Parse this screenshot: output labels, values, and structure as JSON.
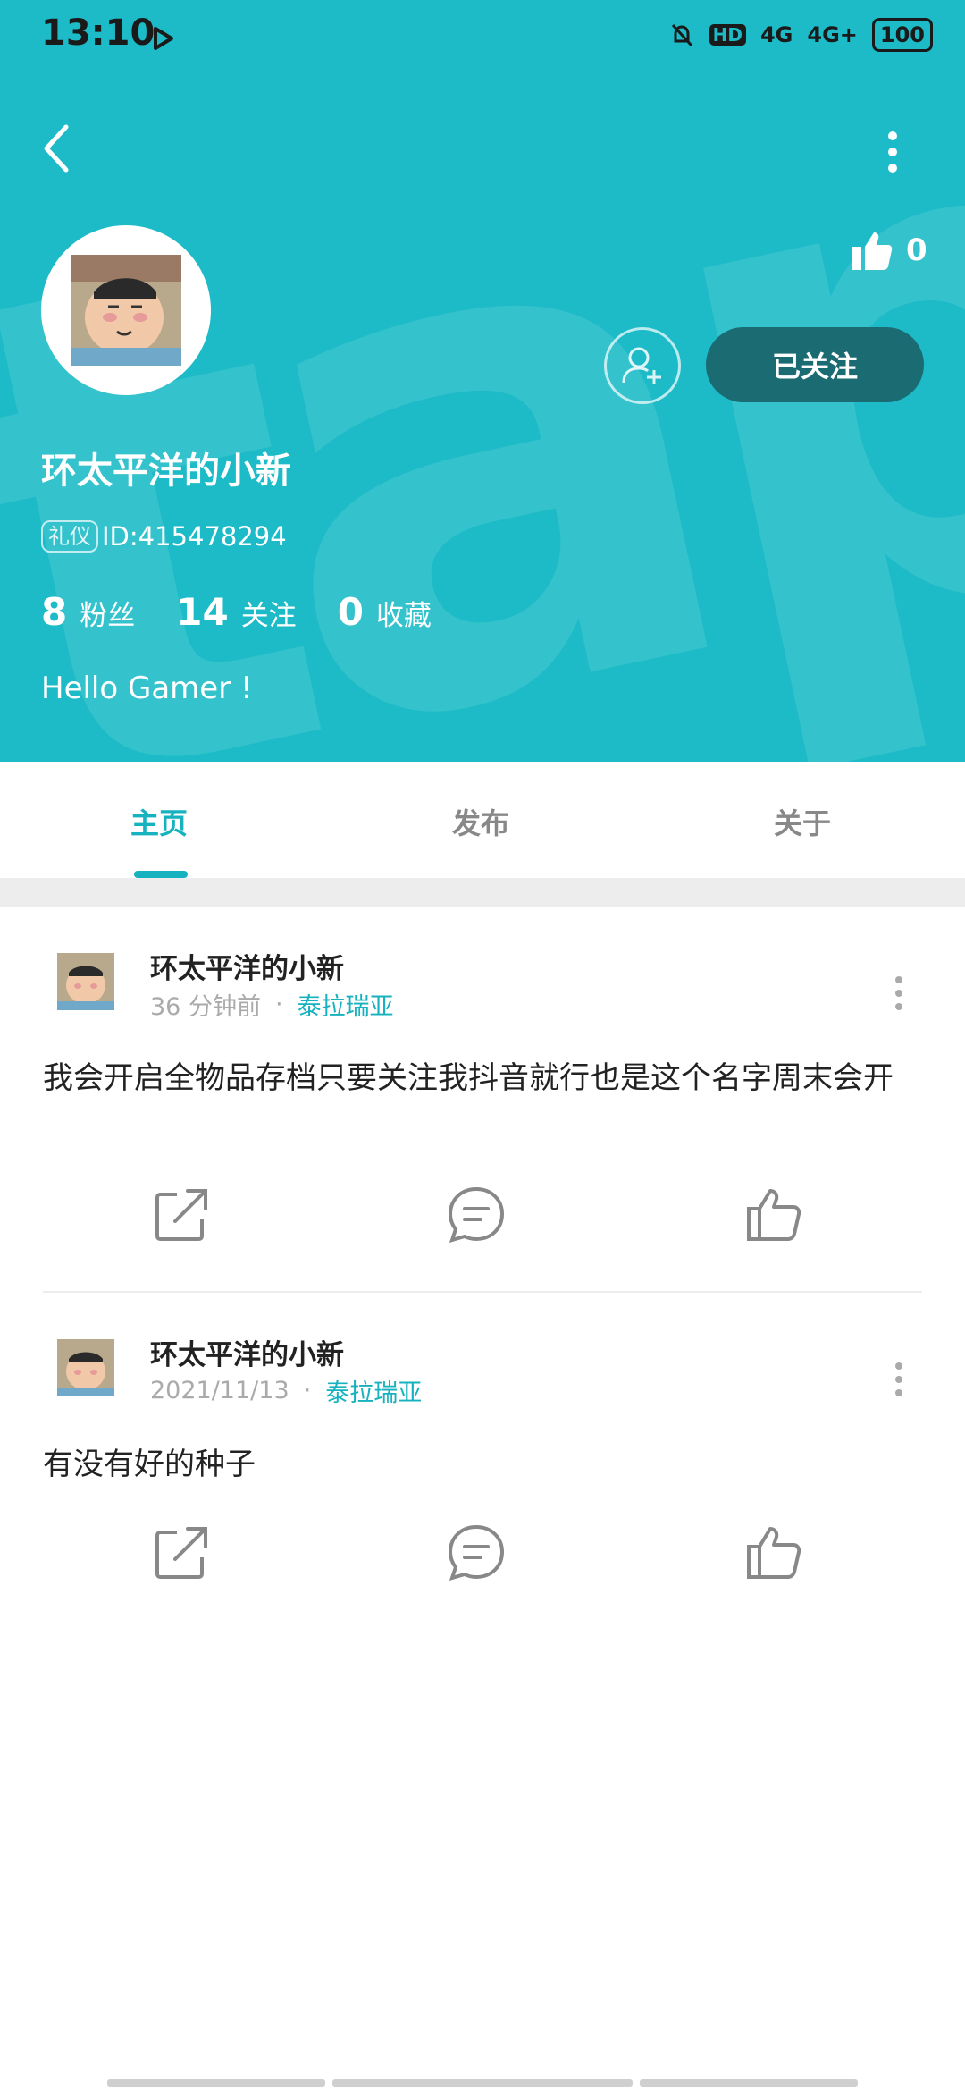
{
  "status_bar": {
    "time": "13:10",
    "hd": "HD",
    "net1": "4G",
    "net2": "4G+",
    "battery": "100"
  },
  "profile": {
    "like_count": "0",
    "follow_button": "已关注",
    "username": "环太平洋的小新",
    "tag": "礼仪",
    "id": "ID:415478294",
    "stats": [
      {
        "value": "8",
        "label": "粉丝"
      },
      {
        "value": "14",
        "label": "关注"
      },
      {
        "value": "0",
        "label": "收藏"
      }
    ],
    "bio": "Hello Gamer !"
  },
  "tabs": [
    {
      "label": "主页",
      "active": true
    },
    {
      "label": "发布",
      "active": false
    },
    {
      "label": "关于",
      "active": false
    }
  ],
  "posts": [
    {
      "author": "环太平洋的小新",
      "time": "36 分钟前",
      "separator": "·",
      "forum": "泰拉瑞亚",
      "text": "我会开启全物品存档只要关注我抖音就行也是这个名字周末会开"
    },
    {
      "author": "环太平洋的小新",
      "time": "2021/11/13",
      "separator": "·",
      "forum": "泰拉瑞亚",
      "text": "有没有好的种子"
    }
  ],
  "icons": {
    "back": "chevron-left-icon",
    "more": "more-vertical-icon",
    "like": "thumbs-up-icon",
    "add_friend": "add-user-icon",
    "share": "share-icon",
    "comment": "comment-icon"
  },
  "colors": {
    "header_bg": "#1dbbc7",
    "accent": "#17b2bf",
    "follow_btn": "#1b6b72"
  }
}
